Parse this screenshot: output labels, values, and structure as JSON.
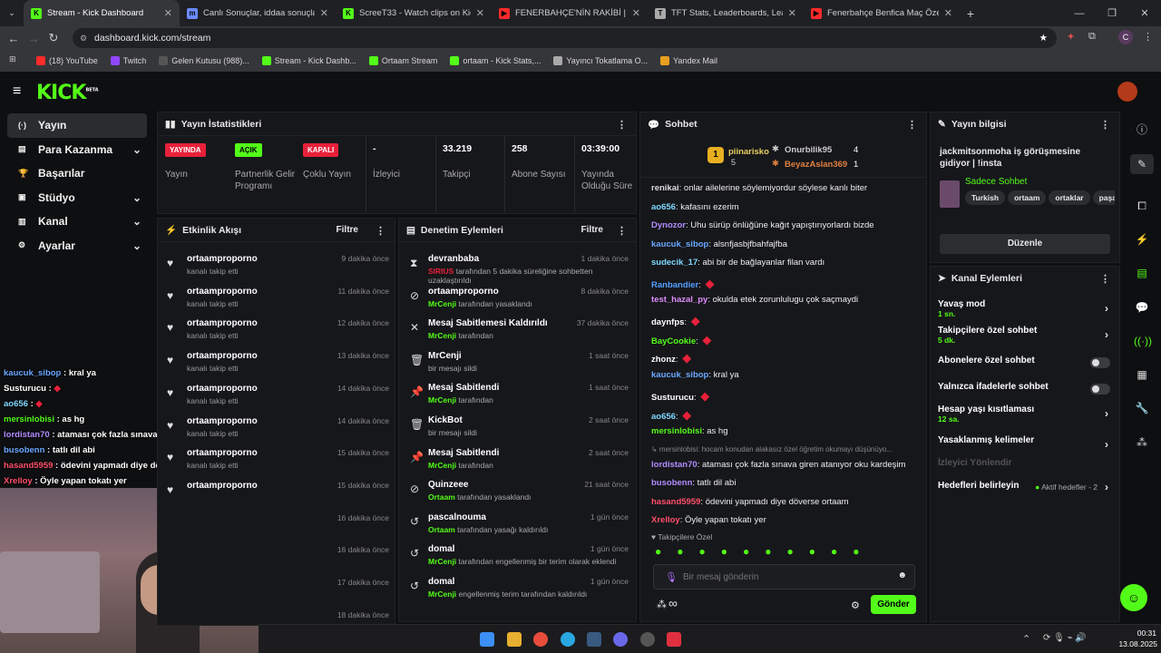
{
  "tabs": [
    {
      "title": "Stream - Kick Dashboard",
      "fav": "K",
      "color": "#53fc18"
    },
    {
      "title": "Canlı Sonuçlar, iddaa sonuçları",
      "fav": "m",
      "color": "#6b8cff"
    },
    {
      "title": "ScreeT33 - Watch clips on Kick",
      "fav": "K",
      "color": "#53fc18"
    },
    {
      "title": "FENERBAHÇE'NİN RAKİBİ | Nice",
      "fav": "▶",
      "color": "#ff2a2a"
    },
    {
      "title": "TFT Stats, Leaderboards, League",
      "fav": "T",
      "color": "#aaaaaa"
    },
    {
      "title": "Fenerbahçe Benfica Maç Özeti",
      "fav": "▶",
      "color": "#ff2a2a"
    }
  ],
  "address": {
    "url": "dashboard.kick.com/stream",
    "profile": "C"
  },
  "bookmarks": [
    "(18) YouTube",
    "Twitch",
    "Gelen Kutusu (988)...",
    "Stream - Kick Dashb...",
    "Ortaam Stream",
    "ortaam - Kick Stats,...",
    "Yayıncı Tokatlama O...",
    "Yandex Mail"
  ],
  "brand": {
    "logo": "KICK",
    "beta": "BETA",
    "accent": "#53fc18"
  },
  "nav": [
    {
      "label": "Yayın",
      "icon": "(·)"
    },
    {
      "label": "Para Kazanma",
      "icon": "▤"
    },
    {
      "label": "Başarılar",
      "icon": "🏆"
    },
    {
      "label": "Stüdyo",
      "icon": "▣"
    },
    {
      "label": "Kanal",
      "icon": "▥"
    },
    {
      "label": "Ayarlar",
      "icon": "⚙"
    }
  ],
  "stats": {
    "title": "Yayın İstatistikleri",
    "items": [
      {
        "badge": "YAYINDA",
        "label": "Yayın"
      },
      {
        "badge": "AÇIK",
        "label": "Partnerlik Gelir Programı"
      },
      {
        "badge": "KAPALI",
        "label": "Çoklu Yayın"
      },
      {
        "value": "-",
        "label": "İzleyici"
      },
      {
        "value": "33.219",
        "label": "Takipçi"
      },
      {
        "value": "258",
        "label": "Abone Sayısı"
      },
      {
        "value": "03:39:00",
        "label": "Yayında Olduğu Süre"
      }
    ]
  },
  "activity": {
    "title": "Etkinlik Akışı",
    "filter": "Filtre",
    "rows": [
      {
        "name": "ortaamproporno",
        "sub": "kanalı takip etti",
        "time": "9 dakika önce"
      },
      {
        "name": "ortaamproporno",
        "sub": "kanalı takip etti",
        "time": "11 dakika önce"
      },
      {
        "name": "ortaamproporno",
        "sub": "kanalı takip etti",
        "time": "12 dakika önce"
      },
      {
        "name": "ortaamproporno",
        "sub": "kanalı takip etti",
        "time": "13 dakika önce"
      },
      {
        "name": "ortaamproporno",
        "sub": "kanalı takip etti",
        "time": "14 dakika önce"
      },
      {
        "name": "ortaamproporno",
        "sub": "kanalı takip etti",
        "time": "14 dakika önce"
      },
      {
        "name": "ortaamproporno",
        "sub": "kanalı takip etti",
        "time": "15 dakika önce"
      },
      {
        "name": "ortaamproporno",
        "sub": "",
        "time": "15 dakika önce"
      },
      {
        "name": "",
        "sub": "",
        "time": "16 dakika önce"
      },
      {
        "name": "",
        "sub": "",
        "time": "16 dakika önce"
      },
      {
        "name": "",
        "sub": "",
        "time": "17 dakika önce"
      },
      {
        "name": "",
        "sub": "",
        "time": "18 dakika önce"
      }
    ]
  },
  "moderation": {
    "title": "Denetim Eylemleri",
    "filter": "Filtre",
    "rows": [
      {
        "icon": "⧗",
        "name": "devranbaba",
        "who": "SIRIUS",
        "sub": "tarafından 5 dakika süreliğine sohbetten uzaklaştırıldı",
        "time": "1 dakika önce"
      },
      {
        "icon": "⊘",
        "name": "ortaamproporno",
        "who": "MrCenji",
        "sub": "tarafından yasaklandı",
        "time": "8 dakika önce"
      },
      {
        "icon": "✕",
        "name": "Mesaj Sabitlemesi Kaldırıldı",
        "who": "MrCenji",
        "sub": "tarafından",
        "time": "37 dakika önce"
      },
      {
        "icon": "🗑",
        "name": "MrCenji",
        "who": "",
        "sub": "bir mesajı sildi",
        "time": "1 saat önce"
      },
      {
        "icon": "📌",
        "name": "Mesaj Sabitlendi",
        "who": "MrCenji",
        "sub": "tarafından",
        "time": "1 saat önce"
      },
      {
        "icon": "🗑",
        "name": "KickBot",
        "who": "",
        "sub": "bir mesajı sildi",
        "time": "2 saat önce"
      },
      {
        "icon": "📌",
        "name": "Mesaj Sabitlendi",
        "who": "MrCenji",
        "sub": "tarafından",
        "time": "2 saat önce"
      },
      {
        "icon": "⊘",
        "name": "Quinzeee",
        "who": "Ortaam",
        "sub": "tarafından yasaklandı",
        "time": "21 saat önce"
      },
      {
        "icon": "↺",
        "name": "pascalnouma",
        "who": "Ortaam",
        "sub": "tarafından yasağı kaldırıldı",
        "time": "1 gün önce"
      },
      {
        "icon": "↺",
        "name": "domal",
        "who": "MrCenji",
        "sub": "tarafından engellenmiş bir terim olarak eklendi",
        "time": "1 gün önce"
      },
      {
        "icon": "↺",
        "name": "domal",
        "who": "MrCenji",
        "sub": "engellenmiş terim  tarafından kaldırıldı",
        "time": "1 gün önce"
      }
    ]
  },
  "chat": {
    "title": "Sohbet",
    "top": [
      {
        "rank": "1",
        "name": "piinarisko",
        "count": "5"
      },
      {
        "name": "Onurbilik95",
        "count": "4"
      },
      {
        "name": "BeyazAslan369",
        "count": "1"
      }
    ],
    "messages": [
      {
        "user": "renikai",
        "color": "#dddddd",
        "text": "onlar ailelerine söylemiyordur söylese kanlı biter"
      },
      {
        "user": "ao656",
        "color": "#7fd7ff",
        "text": "kafasını ezerim"
      },
      {
        "user": "Dynozor",
        "color": "#b18cff",
        "text": "Uhu sürüp önlüğüne kağıt yapıştırıyorlardı bizde"
      },
      {
        "user": "kaucuk_sibop",
        "color": "#6aa7ff",
        "text": "alsnfjasbjfbahfajfba"
      },
      {
        "user": "sudecik_17",
        "color": "#7fd7ff",
        "text": "abi bir de bağlayanlar filan vardı"
      },
      {
        "user": "Ranbandier",
        "color": "#53a0ff",
        "text": ""
      },
      {
        "user": "test_hazal_py",
        "color": "#e08cff",
        "text": "okulda etek zorunlulugu çok saçmaydi"
      },
      {
        "user": "daynfps",
        "color": "#ffffff",
        "text": ""
      },
      {
        "user": "BayCookie",
        "color": "#53fc18",
        "text": ""
      },
      {
        "user": "zhonz",
        "color": "#ffffff",
        "text": ""
      },
      {
        "user": "kaucuk_sibop",
        "color": "#6aa7ff",
        "text": "kral ya"
      },
      {
        "user": "Susturucu",
        "color": "#ffffff",
        "text": ""
      },
      {
        "user": "ao656",
        "color": "#7fd7ff",
        "text": ""
      },
      {
        "user": "mersinlobisi",
        "color": "#53fc18",
        "text": "as hg"
      },
      {
        "user": "",
        "color": "#888888",
        "text": "↳ mersinlobisi: hocam konudan alakasız özel öğretim okumayı düşünüyo..."
      },
      {
        "user": "lordistan70",
        "color": "#b18cff",
        "text": "ataması çok fazla sınava giren atanıyor oku kardeşim"
      },
      {
        "user": "busobenn",
        "color": "#b18cff",
        "text": "tatlı dil abi"
      },
      {
        "user": "hasand5959",
        "color": "#ff4f6a",
        "text": "ödevini yapmadı diye döverse ortaam"
      },
      {
        "user": "Xrelloy",
        "color": "#ff4f6a",
        "text": "Öyle yapan tokatı yer"
      }
    ],
    "followers_only": "Takipçilere Özel",
    "placeholder": "Bir mesaj gönderin",
    "send": "Gönder",
    "infinity": "∞"
  },
  "streaminfo": {
    "title": "Yayın bilgisi",
    "stream_title": "jackmitsonmoha iş görüşmesine gidiyor | !insta",
    "category": "Sadece Sohbet",
    "tags": [
      "Turkish",
      "ortaam",
      "ortaklar",
      "paşala"
    ],
    "edit": "Düzenle"
  },
  "channel_actions": {
    "title": "Kanal Eylemleri",
    "rows": [
      {
        "label": "Yavaş mod",
        "sub": "1 sn.",
        "type": "chev"
      },
      {
        "label": "Takipçilere özel sohbet",
        "sub": "5 dk.",
        "type": "chev"
      },
      {
        "label": "Abonelere özel sohbet",
        "sub": "",
        "type": "toggle"
      },
      {
        "label": "Yalnızca ifadelerle sohbet",
        "sub": "",
        "type": "toggle"
      },
      {
        "label": "Hesap yaşı kısıtlaması",
        "sub": "12 sa.",
        "type": "chev"
      },
      {
        "label": "Yasaklanmış kelimeler",
        "sub": "",
        "type": "chev"
      },
      {
        "label": "İzleyici Yönlendir",
        "sub": "",
        "type": "disabled"
      },
      {
        "label": "Hedefleri belirleyin",
        "sub": "",
        "type": "goal",
        "goal": "Aktif hedefler - 2"
      }
    ]
  },
  "overlay_chat": [
    {
      "user": "kaucuk_sibop",
      "color": "#6aa7ff",
      "text": "kral ya"
    },
    {
      "user": "Susturucu",
      "color": "#ffffff",
      "text": ""
    },
    {
      "user": "ao656",
      "color": "#7fd7ff",
      "text": ""
    },
    {
      "user": "mersinlobisi",
      "color": "#53fc18",
      "text": "as hg"
    },
    {
      "user": "lordistan70",
      "color": "#b18cff",
      "text": "ataması çok fazla sınava giren atanıyor oku kardeşim"
    },
    {
      "user": "busobenn",
      "color": "#6aa7ff",
      "text": "tatlı dil abi"
    },
    {
      "user": "hasand5959",
      "color": "#ff4f6a",
      "text": "ödevini yapmadı diye döverse ortaam"
    },
    {
      "user": "Xrelloy",
      "color": "#ff4f6a",
      "text": "Öyle yapan tokatı yer"
    }
  ],
  "clock": {
    "time": "00:31",
    "date": "13.08.2025"
  }
}
